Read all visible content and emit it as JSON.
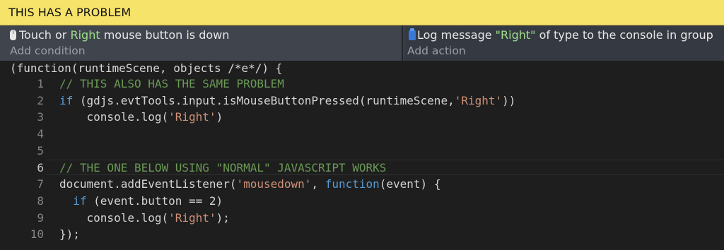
{
  "comment": {
    "text": "THIS HAS A PROBLEM"
  },
  "condition": {
    "pre": "Touch or ",
    "hl": "Right",
    "post": " mouse button is down",
    "add_label": "Add condition"
  },
  "action": {
    "pre": "Log message ",
    "hl": "\"Right\"",
    "post": " of type to the console in group",
    "add_label": "Add action"
  },
  "code": {
    "header": "(function(runtimeScene, objects /*e*/) {",
    "active_line": 6,
    "lines": [
      {
        "n": "1",
        "tokens": [
          {
            "t": "// THIS ALSO HAS THE SAME PROBLEM",
            "c": "com"
          }
        ]
      },
      {
        "n": "2",
        "tokens": [
          {
            "t": "if",
            "c": "kw"
          },
          {
            "t": " (gdjs.evtTools.input.isMouseButtonPressed(runtimeScene,",
            "c": "txt"
          },
          {
            "t": "'Right'",
            "c": "str"
          },
          {
            "t": "))",
            "c": "txt"
          }
        ]
      },
      {
        "n": "3",
        "tokens": [
          {
            "t": "    console.log(",
            "c": "txt"
          },
          {
            "t": "'Right'",
            "c": "str"
          },
          {
            "t": ")",
            "c": "txt"
          }
        ]
      },
      {
        "n": "4",
        "tokens": []
      },
      {
        "n": "5",
        "tokens": []
      },
      {
        "n": "6",
        "tokens": [
          {
            "t": "// THE ONE BELOW USING \"NORMAL\" JAVASCRIPT WORKS",
            "c": "com"
          }
        ]
      },
      {
        "n": "7",
        "tokens": [
          {
            "t": "document.addEventListener(",
            "c": "txt"
          },
          {
            "t": "'mousedown'",
            "c": "str"
          },
          {
            "t": ", ",
            "c": "txt"
          },
          {
            "t": "function",
            "c": "kw"
          },
          {
            "t": "(event) {",
            "c": "txt"
          }
        ]
      },
      {
        "n": "8",
        "tokens": [
          {
            "t": "  ",
            "c": "txt"
          },
          {
            "t": "if",
            "c": "kw"
          },
          {
            "t": " (event.button == 2)",
            "c": "txt"
          }
        ]
      },
      {
        "n": "9",
        "tokens": [
          {
            "t": "    console.log(",
            "c": "txt"
          },
          {
            "t": "'Right'",
            "c": "str"
          },
          {
            "t": ");",
            "c": "txt"
          }
        ]
      },
      {
        "n": "10",
        "tokens": [
          {
            "t": "});",
            "c": "txt"
          }
        ]
      }
    ]
  }
}
